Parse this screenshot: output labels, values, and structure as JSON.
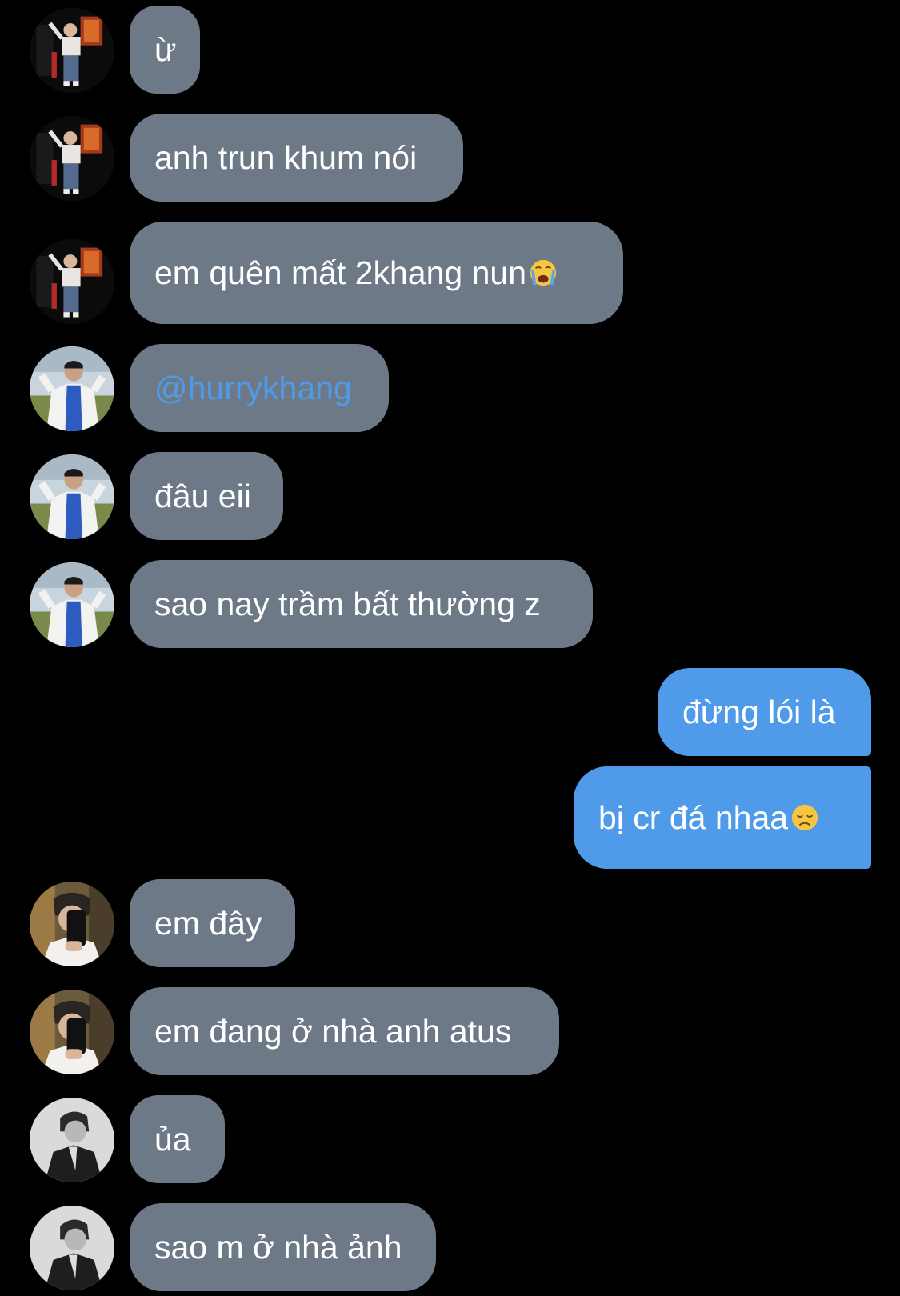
{
  "conversation": {
    "messages": [
      {
        "text": "ừ",
        "direction": "incoming",
        "avatar": "avatar-dark-poster-icon"
      },
      {
        "text": "anh trun khum nói",
        "direction": "incoming",
        "avatar": "avatar-dark-poster-icon"
      },
      {
        "text": "em quên mất 2khang nun",
        "direction": "incoming",
        "avatar": "avatar-dark-poster-icon",
        "emoji": "loudly-crying-face-emoji"
      },
      {
        "text": "@hurrykhang",
        "direction": "incoming",
        "avatar": "avatar-outdoor-white-jacket-icon",
        "is_mention": true
      },
      {
        "text": "đâu eii",
        "direction": "incoming",
        "avatar": "avatar-outdoor-white-jacket-icon"
      },
      {
        "text": "sao nay trầm bất thường z",
        "direction": "incoming",
        "avatar": "avatar-outdoor-white-jacket-icon"
      },
      {
        "text": "đừng lói là",
        "direction": "outgoing"
      },
      {
        "text": "bị cr đá nhaa",
        "direction": "outgoing",
        "emoji": "disappointed-face-emoji"
      },
      {
        "text": "em đây",
        "direction": "incoming",
        "avatar": "avatar-mirror-selfie-icon"
      },
      {
        "text": "em đang ở nhà anh atus",
        "direction": "incoming",
        "avatar": "avatar-mirror-selfie-icon"
      },
      {
        "text": "ủa",
        "direction": "incoming",
        "avatar": "avatar-grayscale-portrait-icon"
      },
      {
        "text": "sao m ở nhà ảnh",
        "direction": "incoming",
        "avatar": "avatar-grayscale-portrait-icon"
      }
    ]
  },
  "colors": {
    "background": "#000000",
    "incoming_bubble": "#6d7987",
    "outgoing_bubble": "#4f9bea",
    "mention_text": "#4f9bea",
    "message_text": "#ffffff"
  }
}
